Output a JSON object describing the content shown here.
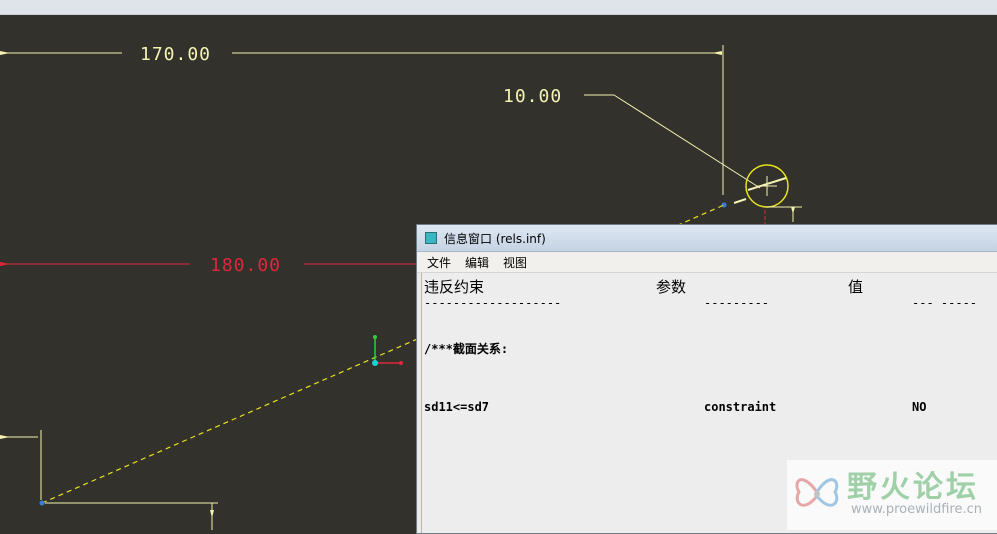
{
  "sketch": {
    "dim_top": "170.00",
    "dim_radius": "10.00",
    "dim_left": "180.00"
  },
  "info_window": {
    "title": "信息窗口 (rels.inf)",
    "menu": [
      "文件",
      "编辑",
      "视图"
    ],
    "headers": {
      "violated": "违反约束",
      "param": "参数",
      "value": "值"
    },
    "separators": {
      "col1": "-------------------",
      "col2": "---------",
      "col3": "--- -----"
    },
    "section_heading": "/***截面关系:",
    "relations": [
      {
        "expr": "sd11<=sd7",
        "type": "constraint",
        "result": "NO"
      }
    ]
  },
  "watermark": {
    "title": "野火论坛",
    "url": "www.proewildfire.cn"
  },
  "colors": {
    "canvas_bg": "#32312c",
    "dimension": "#f4f2b0",
    "dimension_red": "#e0263a",
    "window_bg": "#ecebe6"
  }
}
